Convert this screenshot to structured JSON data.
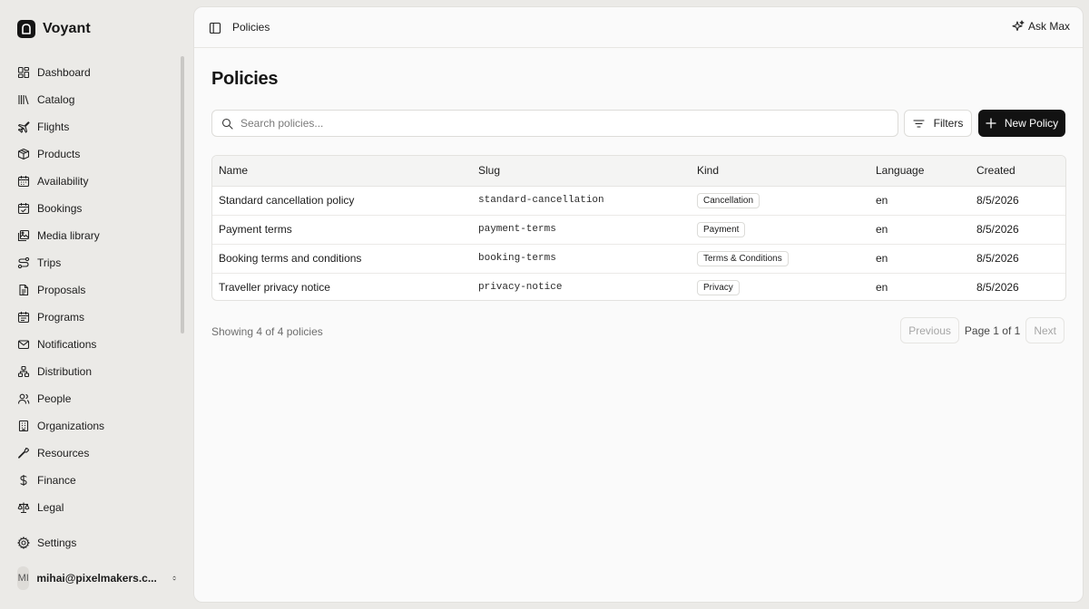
{
  "app": {
    "name": "Voyant"
  },
  "sidebar": {
    "items": [
      {
        "label": "Dashboard",
        "icon": "dashboard-icon"
      },
      {
        "label": "Catalog",
        "icon": "library-icon"
      },
      {
        "label": "Flights",
        "icon": "plane-icon"
      },
      {
        "label": "Products",
        "icon": "package-icon"
      },
      {
        "label": "Availability",
        "icon": "calendar-icon"
      },
      {
        "label": "Bookings",
        "icon": "calendar-check-icon"
      },
      {
        "label": "Media library",
        "icon": "images-icon"
      },
      {
        "label": "Trips",
        "icon": "route-icon"
      },
      {
        "label": "Proposals",
        "icon": "file-text-icon"
      },
      {
        "label": "Programs",
        "icon": "calendar-range-icon"
      },
      {
        "label": "Notifications",
        "icon": "mail-icon"
      },
      {
        "label": "Distribution",
        "icon": "network-icon"
      },
      {
        "label": "People",
        "icon": "users-icon"
      },
      {
        "label": "Organizations",
        "icon": "building-icon"
      },
      {
        "label": "Resources",
        "icon": "wrench-icon"
      },
      {
        "label": "Finance",
        "icon": "dollar-icon"
      },
      {
        "label": "Legal",
        "icon": "scale-icon"
      }
    ],
    "settings": {
      "label": "Settings",
      "icon": "gear-icon"
    },
    "user": {
      "initials": "MI",
      "email": "mihai@pixelmakers.c..."
    }
  },
  "header": {
    "title": "Policies",
    "ask_label": "Ask Max"
  },
  "main": {
    "title": "Policies",
    "search_placeholder": "Search policies...",
    "filters_label": "Filters",
    "new_label": "New Policy",
    "table": {
      "columns": [
        "Name",
        "Slug",
        "Kind",
        "Language",
        "Created"
      ],
      "rows": [
        {
          "name": "Standard cancellation policy",
          "slug": "standard-cancellation",
          "kind": "Cancellation",
          "language": "en",
          "created": "8/5/2026"
        },
        {
          "name": "Payment terms",
          "slug": "payment-terms",
          "kind": "Payment",
          "language": "en",
          "created": "8/5/2026"
        },
        {
          "name": "Booking terms and conditions",
          "slug": "booking-terms",
          "kind": "Terms & Conditions",
          "language": "en",
          "created": "8/5/2026"
        },
        {
          "name": "Traveller privacy notice",
          "slug": "privacy-notice",
          "kind": "Privacy",
          "language": "en",
          "created": "8/5/2026"
        }
      ]
    },
    "footer": {
      "showing": "Showing 4 of 4 policies",
      "prev_label": "Previous",
      "page_label": "Page 1 of 1",
      "next_label": "Next"
    }
  },
  "colors": {
    "primary_button": "#121212",
    "background": "#ebeae7",
    "panel": "#fafafa"
  }
}
